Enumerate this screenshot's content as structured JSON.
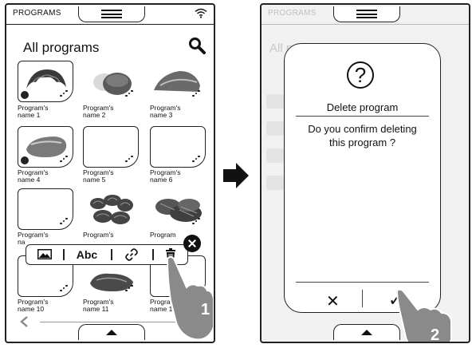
{
  "screen1": {
    "header": "PROGRAMS",
    "title": "All programs",
    "programs": [
      {
        "line1": "Program's",
        "line2": "name 1"
      },
      {
        "line1": "Program's",
        "line2": "name 2"
      },
      {
        "line1": "Program's",
        "line2": "name 3"
      },
      {
        "line1": "Program's",
        "line2": "name 4"
      },
      {
        "line1": "Program's",
        "line2": "name 5"
      },
      {
        "line1": "Program's",
        "line2": "name 6"
      },
      {
        "line1": "Program's",
        "line2": "na"
      },
      {
        "line1": "Program's",
        "line2": ""
      },
      {
        "line1": "Program",
        "line2": ""
      },
      {
        "line1": "Program's",
        "line2": "name 10"
      },
      {
        "line1": "Program's",
        "line2": "name 11"
      },
      {
        "line1": "Program's",
        "line2": "name 12"
      }
    ],
    "toolbar": {
      "text_label": "Abc"
    },
    "step": "1"
  },
  "screen2": {
    "header": "PROGRAMS",
    "faded_title": "All p",
    "dialog": {
      "icon": "?",
      "title": "Delete program",
      "message_line1": "Do you confirm deleting",
      "message_line2": "this program ?",
      "cancel_glyph": "✕",
      "confirm_glyph": "✓"
    },
    "step": "2"
  },
  "icons": [
    "menu-icon",
    "wifi-icon",
    "search-icon",
    "image-icon",
    "link-icon",
    "trash-icon",
    "close-icon",
    "chevron-left-icon",
    "chevron-right-icon",
    "up-arrow-icon",
    "question-icon",
    "arrow-right-icon"
  ],
  "colors": {
    "ink": "#111111",
    "panel_bg": "#ffffff",
    "overlay_bg": "#f1f1f1",
    "hand_gray": "#8a8a8a"
  }
}
